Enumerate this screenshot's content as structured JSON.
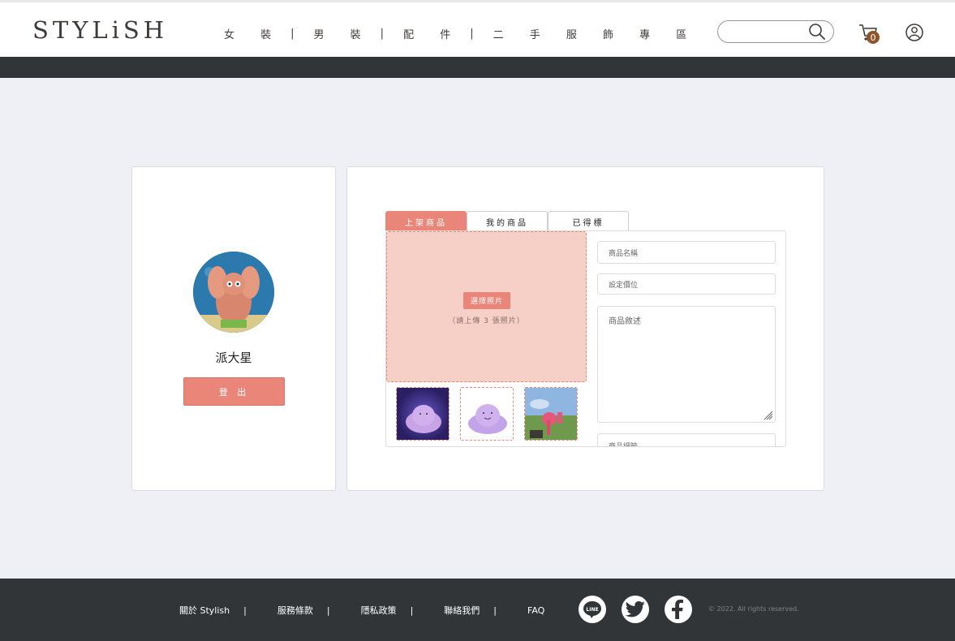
{
  "header": {
    "logo": "STYLiSH",
    "nav": [
      "女 裝",
      "男 裝",
      "配 件",
      "二 手 服 飾 專 區"
    ],
    "nav_separator": "|",
    "search_placeholder": "",
    "cart_count": "0"
  },
  "profile": {
    "name": "派大星",
    "logout_label": "登 出"
  },
  "product": {
    "tabs": [
      {
        "label": "上架商品",
        "active": true
      },
      {
        "label": "我的商品",
        "active": false
      },
      {
        "label": "已得標",
        "active": false
      }
    ],
    "upload_button": "選擇照片",
    "upload_hint": "（請上傳 3 張照片）",
    "fields": {
      "name_placeholder": "商品名稱",
      "price_placeholder": "設定價位",
      "desc_placeholder": "商品敘述",
      "detail_placeholder": "商品細節"
    }
  },
  "footer": {
    "links": [
      "關於 Stylish",
      "服務條款",
      "隱私政策",
      "聯絡我們",
      "FAQ"
    ],
    "separator": "|",
    "social": [
      "line-icon",
      "twitter-icon",
      "facebook-icon"
    ],
    "line_text": "LINE",
    "copyright": "© 2022. All rights reserved."
  },
  "colors": {
    "accent": "#ea8679",
    "upload_bg": "#f6d0c7",
    "dark": "#313538",
    "badge": "#8b572a"
  }
}
